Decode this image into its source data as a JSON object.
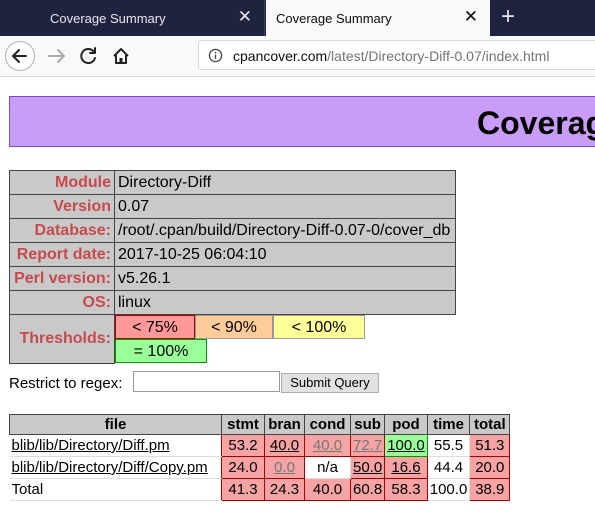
{
  "tabs": [
    {
      "label": "Coverage Summary"
    },
    {
      "label": "Coverage Summary"
    }
  ],
  "url": {
    "host": "cpancover.com",
    "path": "/latest/Directory-Diff-0.07/index.html"
  },
  "banner": {
    "title": "Coverage Summary"
  },
  "info": [
    {
      "key": "Module",
      "value": "Directory-Diff"
    },
    {
      "key": "Version",
      "value": "0.07"
    },
    {
      "key": "Database:",
      "value": "/root/.cpan/build/Directory-Diff-0.07-0/cover_db"
    },
    {
      "key": "Report date:",
      "value": "2017-10-25 06:04:10"
    },
    {
      "key": "Perl version:",
      "value": "v5.26.1"
    },
    {
      "key": "OS:",
      "value": "linux"
    }
  ],
  "thresholds": {
    "label": "Thresholds:",
    "items": [
      {
        "text": "< 75%",
        "color": "#ff9999"
      },
      {
        "text": "< 90%",
        "color": "#ffcc99"
      },
      {
        "text": "< 100%",
        "color": "#ffff99"
      },
      {
        "text": "= 100%",
        "color": "#99ff99"
      }
    ]
  },
  "regex": {
    "label": "Restrict to regex:",
    "value": "",
    "submit": "Submit Query"
  },
  "coverage": {
    "headers": [
      "file",
      "stmt",
      "bran",
      "cond",
      "sub",
      "pod",
      "time",
      "total"
    ],
    "rows": [
      {
        "file": "blib/lib/Directory/Diff.pm",
        "cells": [
          "53.2",
          "40.0",
          "40.0",
          "72.7",
          "100.0",
          "55.5",
          "51.3"
        ]
      },
      {
        "file": "blib/lib/Directory/Diff/Copy.pm",
        "cells": [
          "24.0",
          "0.0",
          "n/a",
          "50.0",
          "16.6",
          "44.4",
          "20.0"
        ]
      },
      {
        "file": "Total",
        "cells": [
          "41.3",
          "24.3",
          "40.0",
          "60.8",
          "58.3",
          "100.0",
          "38.9"
        ]
      }
    ]
  },
  "colors": {
    "banner": "#c99cf8",
    "label_red": "#c74a4a",
    "cell_red": "#f5a3a3",
    "cell_green": "#99ff99"
  }
}
